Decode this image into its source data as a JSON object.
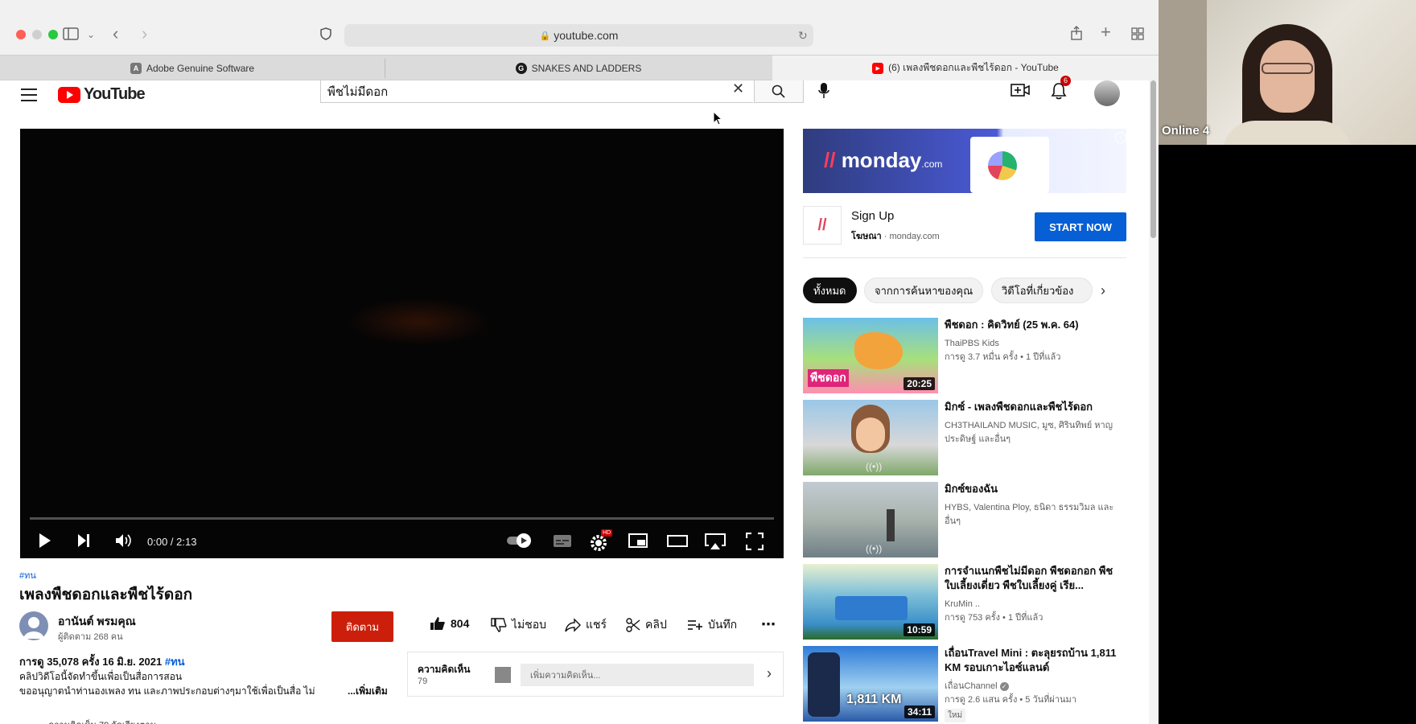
{
  "browser": {
    "url": "youtube.com",
    "tabs": [
      {
        "label": "Adobe Genuine Software",
        "favicon": "A"
      },
      {
        "label": "SNAKES AND LADDERS",
        "favicon": "G"
      },
      {
        "label": "(6) เพลงพืชดอกและพืชไร้ดอก - YouTube",
        "favicon": "▶"
      }
    ]
  },
  "header": {
    "logo_text": "YouTube",
    "search_value": "พืชไม่มีดอก",
    "notification_count": "6"
  },
  "player": {
    "time": "0:00 / 2:13",
    "progress": 0,
    "hd_badge": "HD"
  },
  "video": {
    "hashtag": "#ทน",
    "title": "เพลงพืชดอกและพืชไร้ดอก",
    "channel_name": "อานันต์ พรมคุณ",
    "subscribers": "ผู้ติดตาม 268 คน",
    "subscribe_label": "ติดตาม",
    "likes": "804",
    "dislike_label": "ไม่ชอบ",
    "share_label": "แชร์",
    "clip_label": "คลิป",
    "save_label": "บันทึก",
    "views_date": "การดู 35,078 ครั้ง  16 มิ.ย. 2021 ",
    "views_hashtag": "#ทน",
    "desc_line1": "คลิปวิดีโอนี้จัดทำขึ้นเพื่อเป็นสื่อการสอน",
    "desc_line2": "ขออนุญาตนำท่านองเพลง ทน และภาพประกอบต่างๆมาใช้เพื่อเป็นสื่อ ไม่",
    "more_label": "...เพิ่มเติม",
    "comments_label": "ความคิดเห็น",
    "comments_count": "79",
    "comment_placeholder": "เพิ่มความคิดเห็น..."
  },
  "ad": {
    "brand": "monday",
    "brand_suffix": ".com",
    "title": "Sign Up",
    "sponsored": "โฆษณา",
    "domain": " · monday.com",
    "cta": "START NOW"
  },
  "chips": [
    "ทั้งหมด",
    "จากการค้นหาของคุณ",
    "วิดีโอที่เกี่ยวข้อง"
  ],
  "recommendations": [
    {
      "title": "พืชดอก : คิดวิทย์ (25 พ.ค. 64)",
      "channel": "ThaiPBS Kids",
      "meta": "การดู 3.7 หมื่น ครั้ง • 1 ปีที่แล้ว",
      "duration": "20:25",
      "thumb_label": "พืชดอก"
    },
    {
      "title": "มิกซ์ - เพลงพืชดอกและพืชไร้ดอก",
      "channel": "CH3THAILAND MUSIC, มูซ, ศิรินทิพย์ หาญประดิษฐ์ และอื่นๆ",
      "meta": "",
      "duration": "",
      "live": "((•))"
    },
    {
      "title": "มิกซ์ของฉัน",
      "channel": "HYBS, Valentina Ploy, ธนิดา ธรรมวิมล และอื่นๆ",
      "meta": "",
      "duration": "",
      "live": "((•))"
    },
    {
      "title": "การจำแนกพืชไม่มีดอก พืชดอกอก พืชใบเลี้ยงเดี่ยว พืชใบเลี้ยงคู่ เรีย...",
      "channel": "KruMin ..",
      "meta": "การดู 753 ครั้ง • 1 ปีที่แล้ว",
      "duration": "10:59"
    },
    {
      "title": "เถื่อนTravel Mini : ตะลุยรถบ้าน 1,811 KM รอบเกาะไอซ์แลนด์",
      "channel": "เถื่อนChannel",
      "meta": "การดู 2.6 แสน ครั้ง • 5 วันที่ผ่านมา",
      "duration": "34:11",
      "badge": "ใหม่",
      "thumb_label": "1,811 KM"
    }
  ],
  "webcam": {
    "label": "Online 4"
  },
  "bottom_peek": "ความคิดเห็น 79          จัดเรียงตาม"
}
